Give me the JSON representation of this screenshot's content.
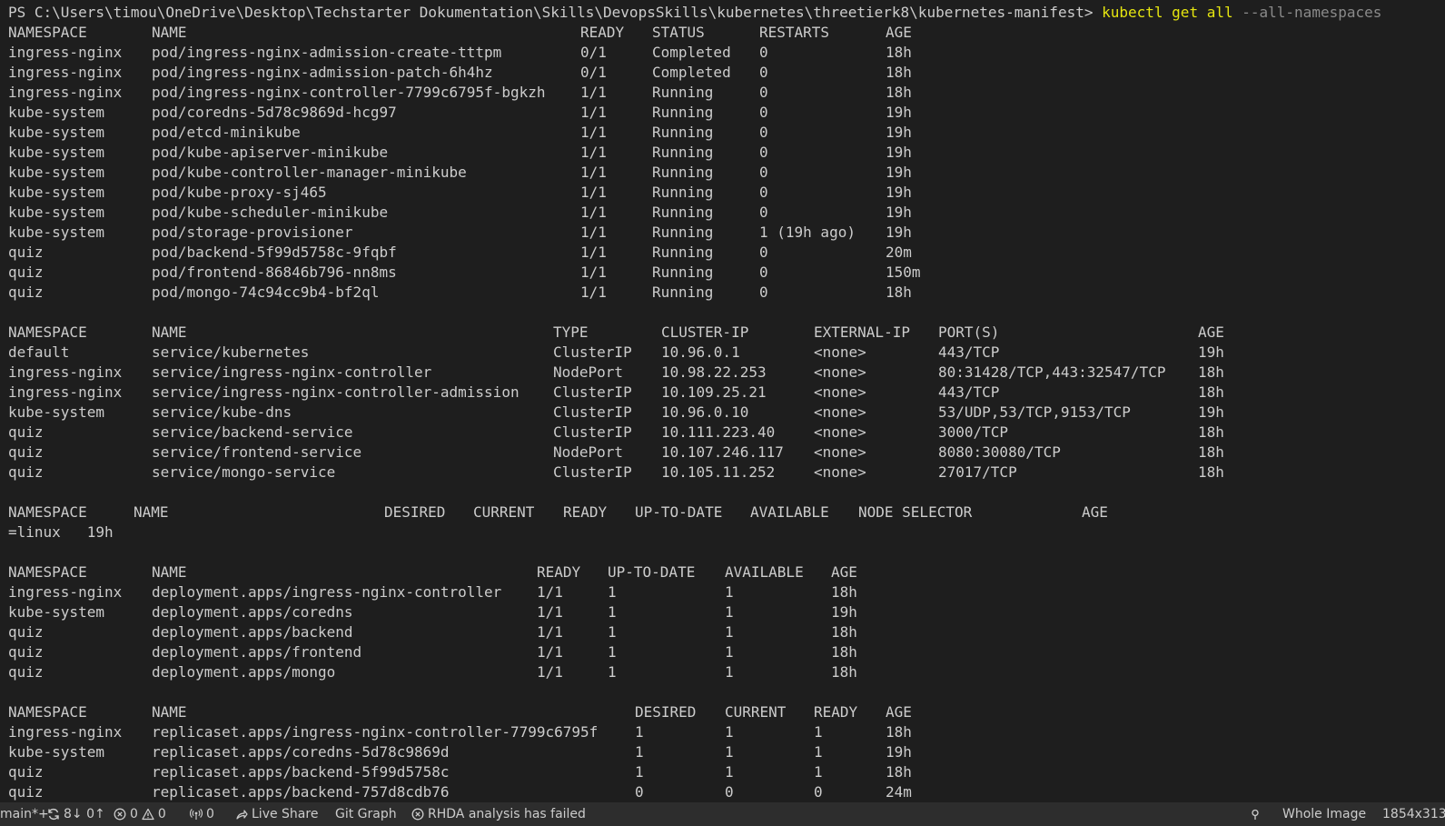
{
  "prompt": {
    "path": "PS C:\\Users\\timou\\OneDrive\\Desktop\\Techstarter Dokumentation\\Skills\\DevopsSkills\\kubernetes\\threetierk8\\kubernetes-manifest>",
    "command": "kubectl get all",
    "flags": "--all-namespaces"
  },
  "pods": {
    "headers": [
      "NAMESPACE",
      "NAME",
      "READY",
      "STATUS",
      "RESTARTS",
      "AGE"
    ],
    "rows": [
      [
        "ingress-nginx",
        "pod/ingress-nginx-admission-create-tttpm",
        "0/1",
        "Completed",
        "0",
        "18h"
      ],
      [
        "ingress-nginx",
        "pod/ingress-nginx-admission-patch-6h4hz",
        "0/1",
        "Completed",
        "0",
        "18h"
      ],
      [
        "ingress-nginx",
        "pod/ingress-nginx-controller-7799c6795f-bgkzh",
        "1/1",
        "Running",
        "0",
        "18h"
      ],
      [
        "kube-system",
        "pod/coredns-5d78c9869d-hcg97",
        "1/1",
        "Running",
        "0",
        "19h"
      ],
      [
        "kube-system",
        "pod/etcd-minikube",
        "1/1",
        "Running",
        "0",
        "19h"
      ],
      [
        "kube-system",
        "pod/kube-apiserver-minikube",
        "1/1",
        "Running",
        "0",
        "19h"
      ],
      [
        "kube-system",
        "pod/kube-controller-manager-minikube",
        "1/1",
        "Running",
        "0",
        "19h"
      ],
      [
        "kube-system",
        "pod/kube-proxy-sj465",
        "1/1",
        "Running",
        "0",
        "19h"
      ],
      [
        "kube-system",
        "pod/kube-scheduler-minikube",
        "1/1",
        "Running",
        "0",
        "19h"
      ],
      [
        "kube-system",
        "pod/storage-provisioner",
        "1/1",
        "Running",
        "1 (19h ago)",
        "19h"
      ],
      [
        "quiz",
        "pod/backend-5f99d5758c-9fqbf",
        "1/1",
        "Running",
        "0",
        "20m"
      ],
      [
        "quiz",
        "pod/frontend-86846b796-nn8ms",
        "1/1",
        "Running",
        "0",
        "150m"
      ],
      [
        "quiz",
        "pod/mongo-74c94cc9b4-bf2ql",
        "1/1",
        "Running",
        "0",
        "18h"
      ]
    ]
  },
  "services": {
    "headers": [
      "NAMESPACE",
      "NAME",
      "TYPE",
      "CLUSTER-IP",
      "EXTERNAL-IP",
      "PORT(S)",
      "AGE"
    ],
    "rows": [
      [
        "default",
        "service/kubernetes",
        "ClusterIP",
        "10.96.0.1",
        "<none>",
        "443/TCP",
        "19h"
      ],
      [
        "ingress-nginx",
        "service/ingress-nginx-controller",
        "NodePort",
        "10.98.22.253",
        "<none>",
        "80:31428/TCP,443:32547/TCP",
        "18h"
      ],
      [
        "ingress-nginx",
        "service/ingress-nginx-controller-admission",
        "ClusterIP",
        "10.109.25.21",
        "<none>",
        "443/TCP",
        "18h"
      ],
      [
        "kube-system",
        "service/kube-dns",
        "ClusterIP",
        "10.96.0.10",
        "<none>",
        "53/UDP,53/TCP,9153/TCP",
        "19h"
      ],
      [
        "quiz",
        "service/backend-service",
        "ClusterIP",
        "10.111.223.40",
        "<none>",
        "3000/TCP",
        "18h"
      ],
      [
        "quiz",
        "service/frontend-service",
        "NodePort",
        "10.107.246.117",
        "<none>",
        "8080:30080/TCP",
        "18h"
      ],
      [
        "quiz",
        "service/mongo-service",
        "ClusterIP",
        "10.105.11.252",
        "<none>",
        "27017/TCP",
        "18h"
      ]
    ]
  },
  "daemonsets": {
    "headers": [
      "NAMESPACE",
      "NAME",
      "DESIRED",
      "CURRENT",
      "READY",
      "UP-TO-DATE",
      "AVAILABLE",
      "NODE SELECTOR",
      "AGE"
    ],
    "wrapped_tail": "=linux   19h"
  },
  "deployments": {
    "headers": [
      "NAMESPACE",
      "NAME",
      "READY",
      "UP-TO-DATE",
      "AVAILABLE",
      "AGE"
    ],
    "rows": [
      [
        "ingress-nginx",
        "deployment.apps/ingress-nginx-controller",
        "1/1",
        "1",
        "1",
        "18h"
      ],
      [
        "kube-system",
        "deployment.apps/coredns",
        "1/1",
        "1",
        "1",
        "19h"
      ],
      [
        "quiz",
        "deployment.apps/backend",
        "1/1",
        "1",
        "1",
        "18h"
      ],
      [
        "quiz",
        "deployment.apps/frontend",
        "1/1",
        "1",
        "1",
        "18h"
      ],
      [
        "quiz",
        "deployment.apps/mongo",
        "1/1",
        "1",
        "1",
        "18h"
      ]
    ]
  },
  "replicasets": {
    "headers": [
      "NAMESPACE",
      "NAME",
      "DESIRED",
      "CURRENT",
      "READY",
      "AGE"
    ],
    "rows": [
      [
        "ingress-nginx",
        "replicaset.apps/ingress-nginx-controller-7799c6795f",
        "1",
        "1",
        "1",
        "18h"
      ],
      [
        "kube-system",
        "replicaset.apps/coredns-5d78c9869d",
        "1",
        "1",
        "1",
        "19h"
      ],
      [
        "quiz",
        "replicaset.apps/backend-5f99d5758c",
        "1",
        "1",
        "1",
        "18h"
      ],
      [
        "quiz",
        "replicaset.apps/backend-757d8cdb76",
        "0",
        "0",
        "0",
        "24m"
      ]
    ]
  },
  "statusbar": {
    "branch": "main*+",
    "sync": "8↓ 0↑",
    "errors": "0",
    "warnings": "0",
    "ports": "0",
    "live_share": "Live Share",
    "git_graph": "Git Graph",
    "rhda": "RHDA analysis has failed",
    "whole_image": "Whole Image",
    "dimensions": "1854x313",
    "icons": {
      "sync": "sync-icon",
      "error": "error-icon",
      "warning": "warning-icon",
      "ports": "broadcast-icon",
      "live_share": "live-share-icon",
      "rhda": "error-circle-icon",
      "location": "location-icon"
    }
  },
  "colors": {
    "background": "#1e1e1e",
    "text": "#cccccc",
    "command": "#e5e510",
    "flags": "#8a8a8a",
    "statusbar": "#2d2d2d"
  }
}
